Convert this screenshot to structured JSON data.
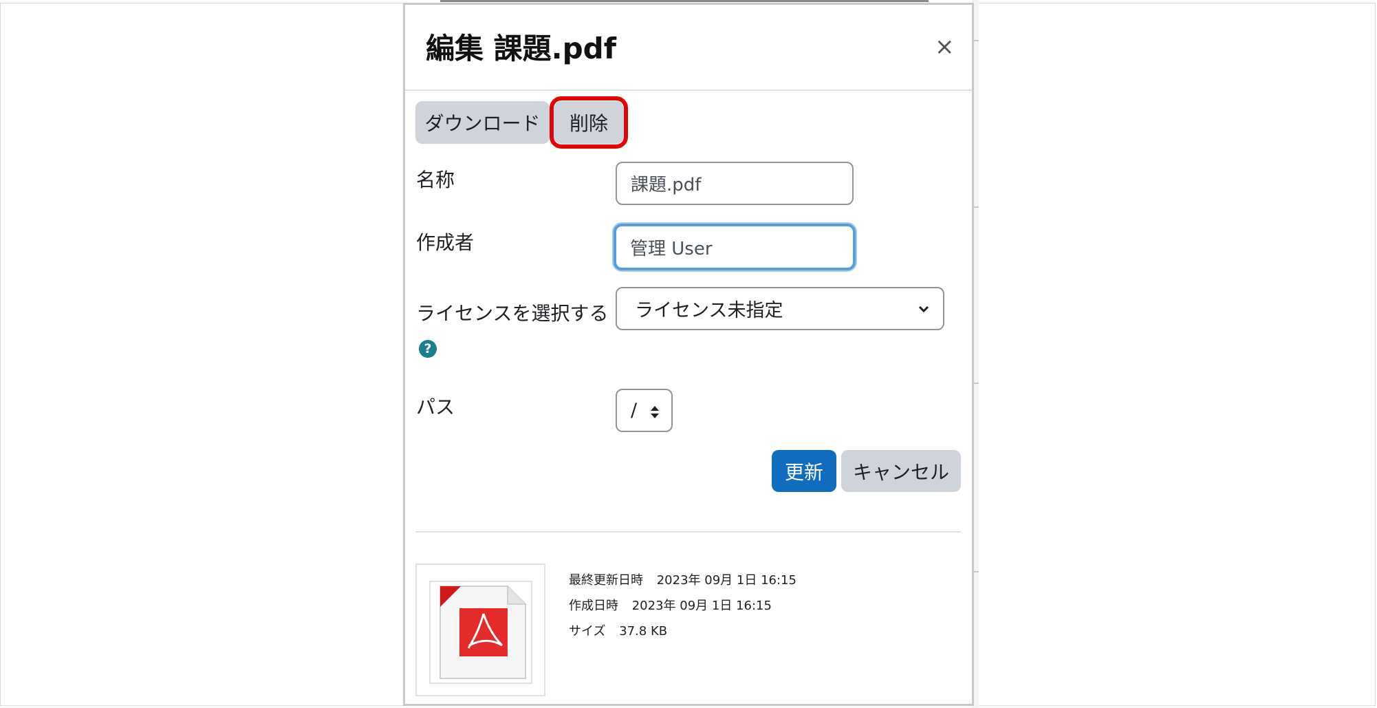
{
  "dialog": {
    "title": "編集 課題.pdf",
    "close_symbol": "×"
  },
  "actions": {
    "download_label": "ダウンロード",
    "delete_label": "削除"
  },
  "form": {
    "name_label": "名称",
    "name_value": "課題.pdf",
    "author_label": "作成者",
    "author_value": "管理 User",
    "license_label": "ライセンスを選択する",
    "license_selected": "ライセンス未指定",
    "help_icon_glyph": "?",
    "path_label": "パス",
    "path_selected": "/"
  },
  "buttons": {
    "update_label": "更新",
    "cancel_label": "キャンセル"
  },
  "file_info": {
    "icon": "pdf-file-icon",
    "modified_label": "最終更新日時",
    "modified_value": "2023年 09月 1日 16:15",
    "created_label": "作成日時",
    "created_value": "2023年 09月 1日 16:15",
    "size_label": "サイズ",
    "size_value": "37.8 KB"
  },
  "colors": {
    "primary": "#0f6cbf",
    "secondary": "#ced4da",
    "highlight": "#e60000",
    "focus": "#5a9cdb",
    "help": "#1b7f8c"
  }
}
